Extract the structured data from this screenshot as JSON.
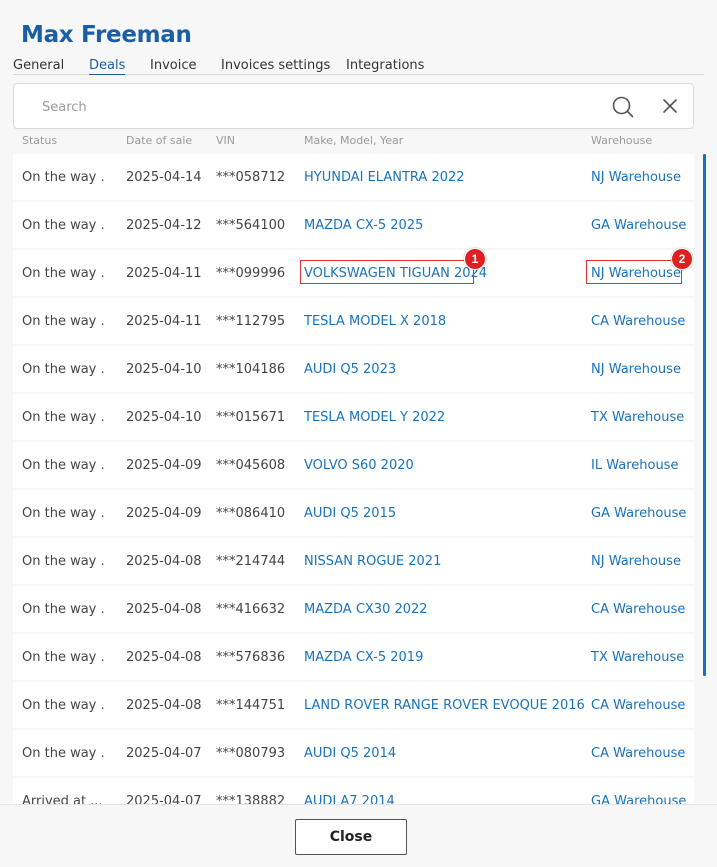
{
  "header": {
    "title": "Max Freeman"
  },
  "tabs": [
    {
      "label": "General",
      "active": false
    },
    {
      "label": "Deals",
      "active": true
    },
    {
      "label": "Invoice",
      "active": false
    },
    {
      "label": "Invoices settings",
      "active": false
    },
    {
      "label": "Integrations",
      "active": false
    }
  ],
  "search": {
    "placeholder": "Search",
    "value": ""
  },
  "columns": {
    "status": "Status",
    "date": "Date of sale",
    "vin": "VIN",
    "model": "Make, Model, Year",
    "warehouse": "Warehouse"
  },
  "rows": [
    {
      "status": "On the way ...",
      "date": "2025-04-14",
      "vin": "***058712",
      "model": "HYUNDAI ELANTRA 2022",
      "warehouse": "NJ Warehouse"
    },
    {
      "status": "On the way ...",
      "date": "2025-04-12",
      "vin": "***564100",
      "model": "MAZDA CX-5 2025",
      "warehouse": "GA Warehouse"
    },
    {
      "status": "On the way ...",
      "date": "2025-04-11",
      "vin": "***099996",
      "model": "VOLKSWAGEN TIGUAN 2024",
      "warehouse": "NJ Warehouse"
    },
    {
      "status": "On the way ...",
      "date": "2025-04-11",
      "vin": "***112795",
      "model": "TESLA MODEL X 2018",
      "warehouse": "CA Warehouse"
    },
    {
      "status": "On the way ...",
      "date": "2025-04-10",
      "vin": "***104186",
      "model": "AUDI Q5 2023",
      "warehouse": "NJ Warehouse"
    },
    {
      "status": "On the way ...",
      "date": "2025-04-10",
      "vin": "***015671",
      "model": "TESLA MODEL Y 2022",
      "warehouse": "TX Warehouse"
    },
    {
      "status": "On the way ...",
      "date": "2025-04-09",
      "vin": "***045608",
      "model": "VOLVO S60 2020",
      "warehouse": "IL Warehouse"
    },
    {
      "status": "On the way ...",
      "date": "2025-04-09",
      "vin": "***086410",
      "model": "AUDI Q5 2015",
      "warehouse": "GA Warehouse"
    },
    {
      "status": "On the way ...",
      "date": "2025-04-08",
      "vin": "***214744",
      "model": "NISSAN ROGUE 2021",
      "warehouse": "NJ Warehouse"
    },
    {
      "status": "On the way ...",
      "date": "2025-04-08",
      "vin": "***416632",
      "model": "MAZDA CX30 2022",
      "warehouse": "CA Warehouse"
    },
    {
      "status": "On the way ...",
      "date": "2025-04-08",
      "vin": "***576836",
      "model": "MAZDA CX-5 2019",
      "warehouse": "TX Warehouse"
    },
    {
      "status": "On the way ...",
      "date": "2025-04-08",
      "vin": "***144751",
      "model": "LAND ROVER RANGE ROVER EVOQUE 2016",
      "warehouse": "CA Warehouse"
    },
    {
      "status": "On the way ...",
      "date": "2025-04-07",
      "vin": "***080793",
      "model": "AUDI Q5 2014",
      "warehouse": "CA Warehouse"
    },
    {
      "status": "Arrived at ...",
      "date": "2025-04-07",
      "vin": "***138882",
      "model": "AUDI A7 2014",
      "warehouse": "GA Warehouse"
    }
  ],
  "annotations": [
    {
      "label": "1"
    },
    {
      "label": "2"
    }
  ],
  "footer": {
    "close_label": "Close"
  },
  "colors": {
    "accent": "#1a5fa6",
    "link": "#1a72b9",
    "highlight": "#e53030"
  },
  "icons": {
    "search": "search-icon",
    "clear": "close-icon"
  }
}
